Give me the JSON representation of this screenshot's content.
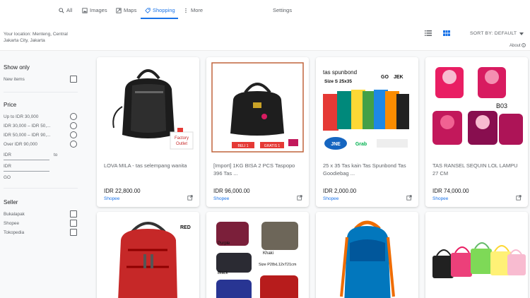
{
  "nav": {
    "tabs": [
      {
        "label": "All",
        "icon": "search-icon"
      },
      {
        "label": "Images",
        "icon": "image-icon"
      },
      {
        "label": "Maps",
        "icon": "map-icon"
      },
      {
        "label": "Shopping",
        "icon": "tag-icon",
        "active": true
      },
      {
        "label": "More",
        "icon": "more-vert-icon"
      }
    ],
    "settings": "Settings"
  },
  "location": "Your location: Menteng, Central Jakarta City, Jakarta",
  "sort": {
    "label": "SORT BY: DEFAULT"
  },
  "about": "About",
  "filters": {
    "show_only": {
      "heading": "Show only",
      "items": [
        "New items"
      ]
    },
    "price": {
      "heading": "Price",
      "options": [
        "Up to IDR 30,000",
        "IDR 30,000 – IDR 50,...",
        "IDR 50,000 – IDR 90,...",
        "Over IDR 90,000"
      ],
      "min_placeholder": "IDR",
      "to": "to",
      "max_placeholder": "IDR",
      "go": "GO"
    },
    "seller": {
      "heading": "Seller",
      "items": [
        "Bukalapak",
        "Shopee",
        "Tokopedia"
      ]
    }
  },
  "products": [
    {
      "title": "LOVA MILA - tas selempang wanita",
      "price": "IDR 22,800.00",
      "store": "Shopee",
      "image_text": [
        "Factory",
        "Outlet"
      ]
    },
    {
      "title": "[Import] 1KG BISA 2 PCS Taspopo 396 Tas ...",
      "price": "IDR 96,000.00",
      "store": "Shopee",
      "image_text": [
        "BELI 1",
        "GRATIS 1"
      ]
    },
    {
      "title": "25 x 35 Tas kain Tas Spunbond Tas Goodiebag ...",
      "price": "IDR 2,000.00",
      "store": "Shopee",
      "image_text": [
        "tas spunbond",
        "GO",
        "JEK",
        "Size S 25x35",
        "JNE",
        "Grab"
      ]
    },
    {
      "title": "TAS RANSEL SEQUIN LOL LAMPU 27 CM",
      "price": "IDR 74,000.00",
      "store": "Shopee",
      "image_text": [
        "B03"
      ]
    },
    {
      "title": "",
      "price": "",
      "store": "",
      "image_text": [
        "RED"
      ]
    },
    {
      "title": "",
      "price": "",
      "store": "",
      "image_text": [
        "Purple",
        "Black",
        "Khaki",
        "Size P28xL12xT21cm"
      ]
    },
    {
      "title": "",
      "price": "",
      "store": "",
      "image_text": []
    },
    {
      "title": "",
      "price": "",
      "store": "",
      "image_text": []
    }
  ],
  "colors": {
    "accent": "#1a73e8",
    "text": "#5f6368",
    "heading": "#202124"
  }
}
